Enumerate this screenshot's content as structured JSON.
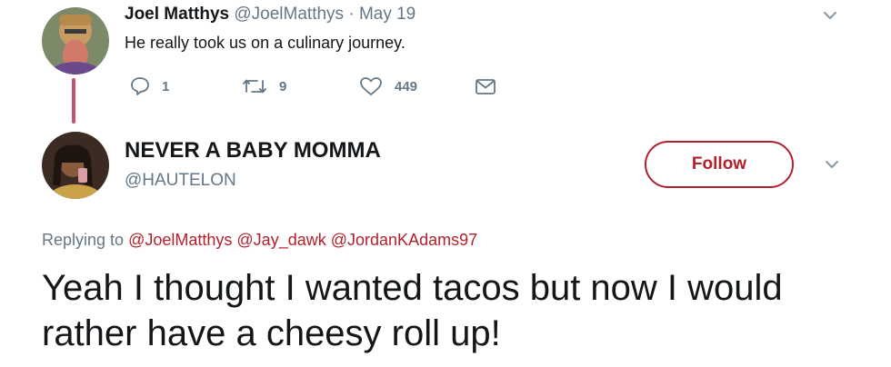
{
  "parent_tweet": {
    "display_name": "Joel Matthys",
    "handle": "@JoelMatthys",
    "separator": "·",
    "date": "May 19",
    "text": "He really took us on a culinary journey.",
    "avatar_icon": "user-avatar-icon",
    "actions": {
      "reply_count": "1",
      "retweet_count": "9",
      "like_count": "449",
      "icons": [
        "reply-icon",
        "retweet-icon",
        "like-icon",
        "message-icon"
      ]
    }
  },
  "reply_tweet": {
    "display_name": "NEVER A BABY MOMMA",
    "handle": "@HAUTELON",
    "follow_label": "Follow",
    "replying_to_label": "Replying to",
    "mentions": [
      "@JoelMatthys",
      "@Jay_dawk",
      "@JordanKAdams97"
    ],
    "text": "Yeah I thought I wanted tacos but now I would rather have a cheesy roll up!",
    "avatar_icon": "user-avatar-icon"
  },
  "colors": {
    "accent": "#b31f2b",
    "thread_line": "#c1536e",
    "secondary_text": "#657786",
    "primary_text": "#14171a"
  }
}
